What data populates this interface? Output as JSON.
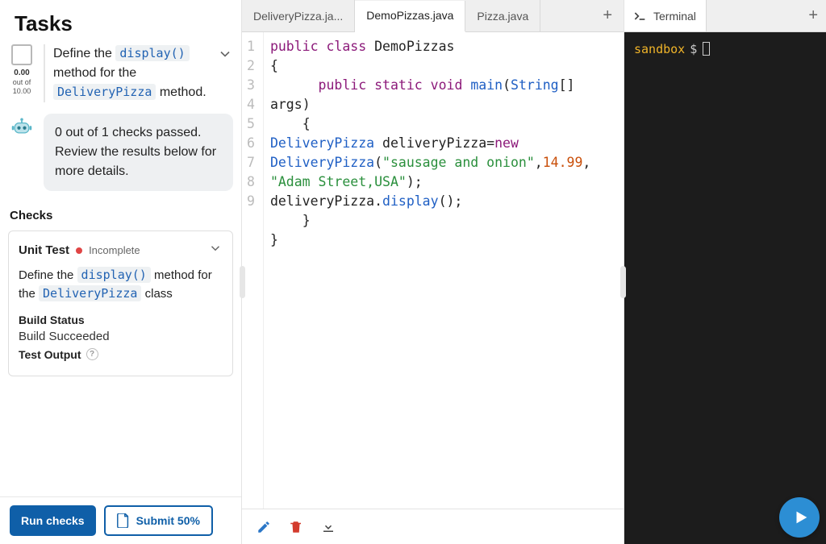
{
  "left": {
    "title": "Tasks",
    "score_value": "0.00",
    "score_mid": "out of",
    "score_total": "10.00",
    "task_desc_pre": "Define the ",
    "task_desc_code1": "display()",
    "task_desc_mid": " method for the ",
    "task_desc_code2": "DeliveryPizza",
    "task_desc_post": " method.",
    "bot_msg": "0 out of 1 checks passed. Review the results below for more details.",
    "checks_heading": "Checks",
    "check": {
      "title": "Unit Test",
      "status": "Incomplete",
      "desc_pre": "Define the ",
      "desc_code1": "display()",
      "desc_mid": " method for the ",
      "desc_code2": "DeliveryPizza",
      "desc_post": " class",
      "build_h": "Build Status",
      "build_v": "Build Succeeded",
      "test_h": "Test Output"
    },
    "run_label": "Run checks",
    "submit_label": "Submit 50%"
  },
  "editor": {
    "tabs": [
      "DeliveryPizza.ja...",
      "DemoPizzas.java",
      "Pizza.java"
    ],
    "active_tab": 1,
    "lines": [
      1,
      2,
      3,
      4,
      5,
      6,
      7,
      8,
      9
    ]
  },
  "code": {
    "l1_public": "public",
    "l1_class": "class",
    "l1_name": "DemoPizzas",
    "l2": "{",
    "l3_indent": "      ",
    "l3_public": "public",
    "l3_static": "static",
    "l3_void": "void",
    "l3_main": "main",
    "l3_po": "(",
    "l3_type": "String",
    "l3_br": "[]",
    "l3w_args": "args",
    "l3w_pc": ")",
    "l4_indent": "    ",
    "l4": "{",
    "l5_type": "DeliveryPizza",
    "l5_var": " deliveryPizza",
    "l5_eq": "=",
    "l5_new": "new",
    "l5w_type": "DeliveryPizza",
    "l5w_po": "(",
    "l5w_str1": "\"sausage and onion\"",
    "l5w_c1": ",",
    "l5w_num": "14.99",
    "l5w_c2": ",",
    "l5w2_str2": "\"Adam Street,USA\"",
    "l5w2_pcsemi": ");",
    "l6_pre": "deliveryPizza",
    "l6_dot": ".",
    "l6_fn": "display",
    "l6_end": "();",
    "l7_indent": "    ",
    "l7": "}",
    "l8": "}"
  },
  "terminal": {
    "title": "Terminal",
    "prompt": "sandbox",
    "dollar": "$"
  }
}
